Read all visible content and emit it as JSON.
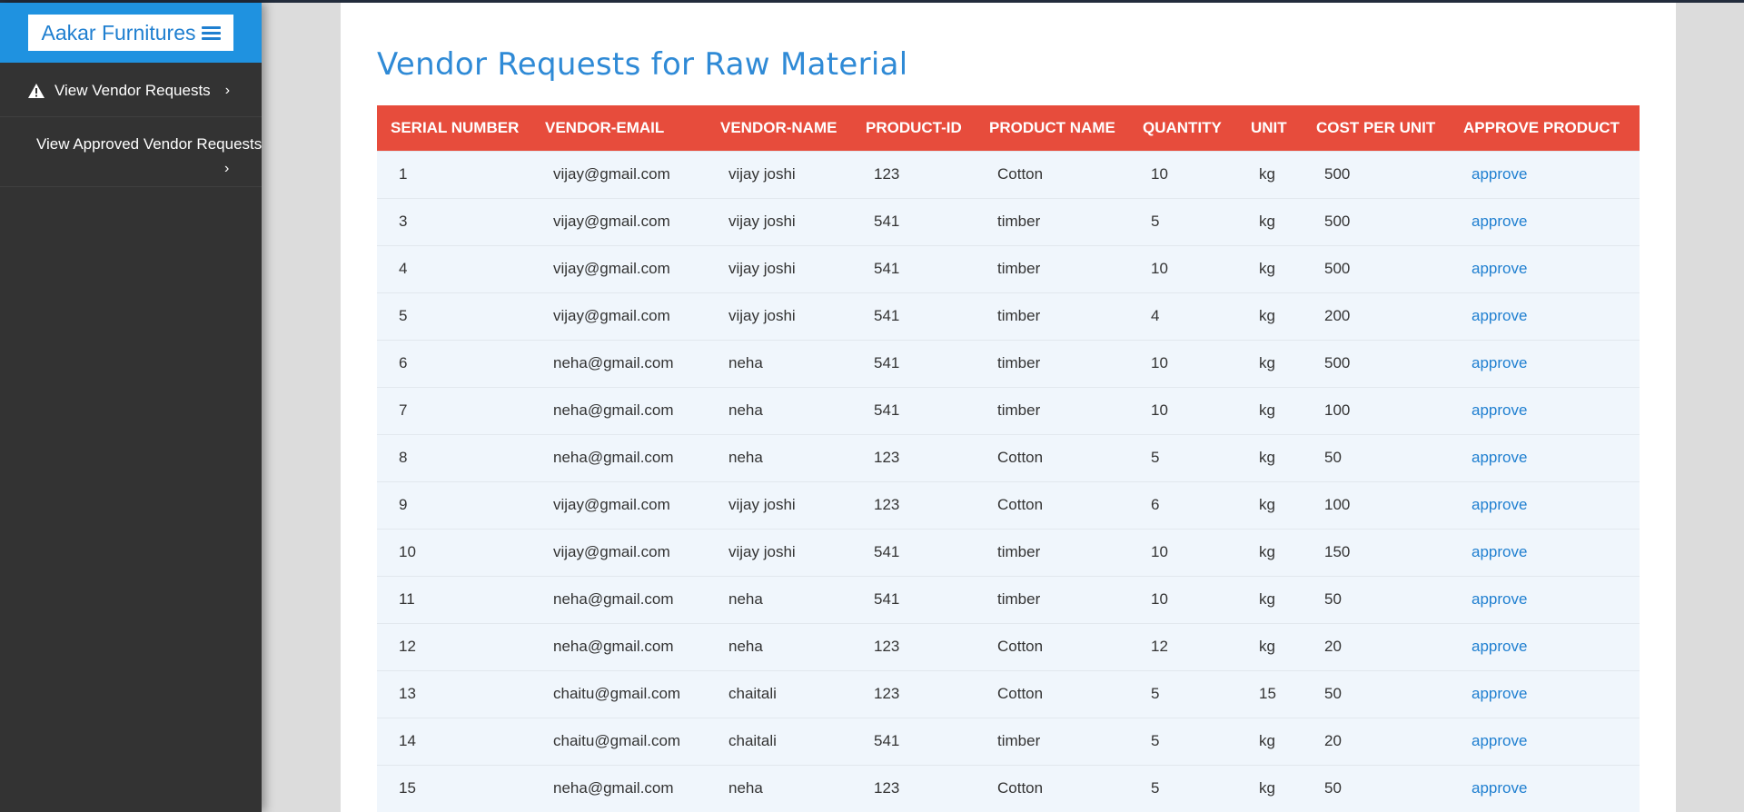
{
  "sidebar": {
    "brand": "Aakar Furnitures",
    "items": [
      {
        "label": "View Vendor Requests"
      },
      {
        "label": "View Approved Vendor Requests"
      }
    ]
  },
  "main": {
    "title": "Vendor Requests for Raw Material",
    "columns": [
      "SERIAL NUMBER",
      "VENDOR-EMAIL",
      "VENDOR-NAME",
      "PRODUCT-ID",
      "PRODUCT NAME",
      "QUANTITY",
      "UNIT",
      "COST PER UNIT",
      "APPROVE PRODUCT"
    ],
    "rows": [
      [
        "1",
        "vijay@gmail.com",
        "vijay joshi",
        "123",
        "Cotton",
        "10",
        "kg",
        "500",
        "approve"
      ],
      [
        "3",
        "vijay@gmail.com",
        "vijay joshi",
        "541",
        "timber",
        "5",
        "kg",
        "500",
        "approve"
      ],
      [
        "4",
        "vijay@gmail.com",
        "vijay joshi",
        "541",
        "timber",
        "10",
        "kg",
        "500",
        "approve"
      ],
      [
        "5",
        "vijay@gmail.com",
        "vijay joshi",
        "541",
        "timber",
        "4",
        "kg",
        "200",
        "approve"
      ],
      [
        "6",
        "neha@gmail.com",
        "neha",
        "541",
        "timber",
        "10",
        "kg",
        "500",
        "approve"
      ],
      [
        "7",
        "neha@gmail.com",
        "neha",
        "541",
        "timber",
        "10",
        "kg",
        "100",
        "approve"
      ],
      [
        "8",
        "neha@gmail.com",
        "neha",
        "123",
        "Cotton",
        "5",
        "kg",
        "50",
        "approve"
      ],
      [
        "9",
        "vijay@gmail.com",
        "vijay joshi",
        "123",
        "Cotton",
        "6",
        "kg",
        "100",
        "approve"
      ],
      [
        "10",
        "vijay@gmail.com",
        "vijay joshi",
        "541",
        "timber",
        "10",
        "kg",
        "150",
        "approve"
      ],
      [
        "11",
        "neha@gmail.com",
        "neha",
        "541",
        "timber",
        "10",
        "kg",
        "50",
        "approve"
      ],
      [
        "12",
        "neha@gmail.com",
        "neha",
        "123",
        "Cotton",
        "12",
        "kg",
        "20",
        "approve"
      ],
      [
        "13",
        "chaitu@gmail.com",
        "chaitali",
        "123",
        "Cotton",
        "5",
        "15",
        "50",
        "approve"
      ],
      [
        "14",
        "chaitu@gmail.com",
        "chaitali",
        "541",
        "timber",
        "5",
        "kg",
        "20",
        "approve"
      ],
      [
        "15",
        "neha@gmail.com",
        "neha",
        "123",
        "Cotton",
        "5",
        "kg",
        "50",
        "approve"
      ]
    ]
  },
  "colors": {
    "brand_bar": "#1f92e0",
    "sidebar_bg": "#333333",
    "table_header": "#e74c3c",
    "row_bg": "#f0f6fc",
    "link": "#1f7fd0",
    "title": "#2f8ad6"
  },
  "icons": {
    "menu": "hamburger-icon",
    "warning": "warning-triangle-icon",
    "chevron": "chevron-right-icon"
  }
}
